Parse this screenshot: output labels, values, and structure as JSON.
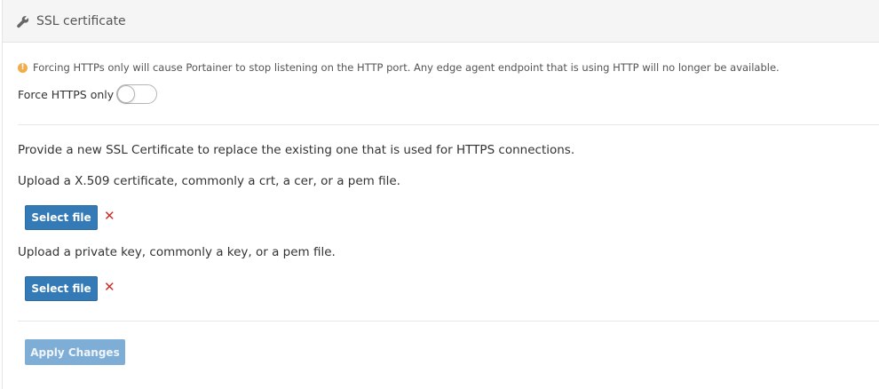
{
  "header": {
    "title": "SSL certificate",
    "icon": "wrench-icon"
  },
  "warning": {
    "icon": "exclamation-circle-icon",
    "color": "#f0ad4e",
    "text": "Forcing HTTPs only will cause Portainer to stop listening on the HTTP port. Any edge agent endpoint that is using HTTP will no longer be available."
  },
  "force_https": {
    "label": "Force HTTPS only",
    "enabled": false
  },
  "description": "Provide a new SSL Certificate to replace the existing one that is used for HTTPS connections.",
  "certificate": {
    "label": "Upload a X.509 certificate, commonly a crt, a cer, or a pem file.",
    "button_label": "Select file",
    "remove_icon": "times-icon"
  },
  "private_key": {
    "label": "Upload a private key, commonly a key, or a pem file.",
    "button_label": "Select file",
    "remove_icon": "times-icon"
  },
  "actions": {
    "apply_label": "Apply Changes"
  },
  "colors": {
    "primary": "#337ab7",
    "primary_disabled": "#7eaed6",
    "danger": "#c9302c",
    "warning": "#f0ad4e"
  }
}
